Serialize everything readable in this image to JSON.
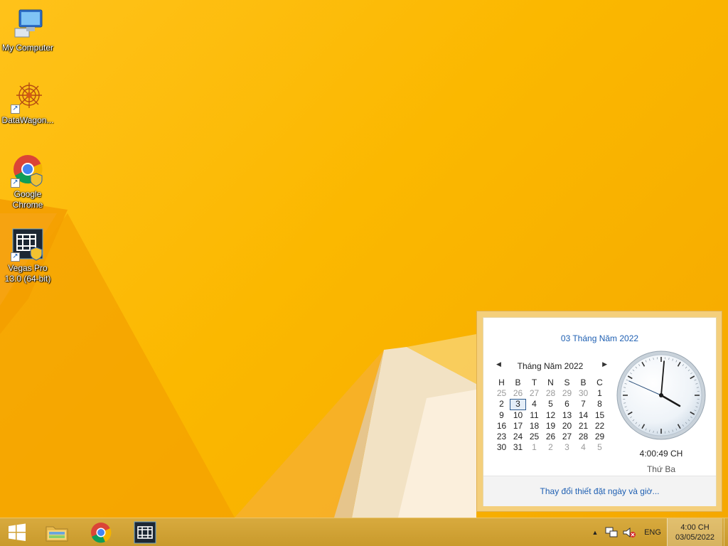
{
  "colors": {
    "accent": "#1e5fb2",
    "taskbar": "#cfa035",
    "wallpaper": "#fbb800"
  },
  "desktop": {
    "icons": [
      {
        "label": "My Computer",
        "icon": "my-computer-icon"
      },
      {
        "label": "DataWagon...",
        "icon": "datawagon-icon"
      },
      {
        "label": "Google Chrome",
        "icon": "chrome-icon"
      },
      {
        "label": "Vegas Pro 13.0 (64-bit)",
        "icon": "vegas-pro-icon"
      }
    ]
  },
  "flyout": {
    "long_date": "03 Tháng Năm 2022",
    "month_title": "Tháng Năm 2022",
    "weekday_headers": [
      "H",
      "B",
      "T",
      "N",
      "S",
      "B",
      "C"
    ],
    "weeks": [
      [
        "25",
        "26",
        "27",
        "28",
        "29",
        "30",
        "1"
      ],
      [
        "2",
        "3",
        "4",
        "5",
        "6",
        "7",
        "8"
      ],
      [
        "9",
        "10",
        "11",
        "12",
        "13",
        "14",
        "15"
      ],
      [
        "16",
        "17",
        "18",
        "19",
        "20",
        "21",
        "22"
      ],
      [
        "23",
        "24",
        "25",
        "26",
        "27",
        "28",
        "29"
      ],
      [
        "30",
        "31",
        "1",
        "2",
        "3",
        "4",
        "5"
      ]
    ],
    "time": "4:00:49 CH",
    "day_name": "Thứ Ba",
    "settings_link": "Thay đổi thiết đặt ngày và giờ...",
    "clock": {
      "hours": 4,
      "minutes": 0,
      "seconds": 49
    }
  },
  "taskbar": {
    "pinned": [
      "windows-start-icon",
      "file-explorer-icon",
      "chrome-icon",
      "vegas-pro-icon"
    ],
    "language": "ENG",
    "time": "4:00 CH",
    "date": "03/05/2022"
  }
}
